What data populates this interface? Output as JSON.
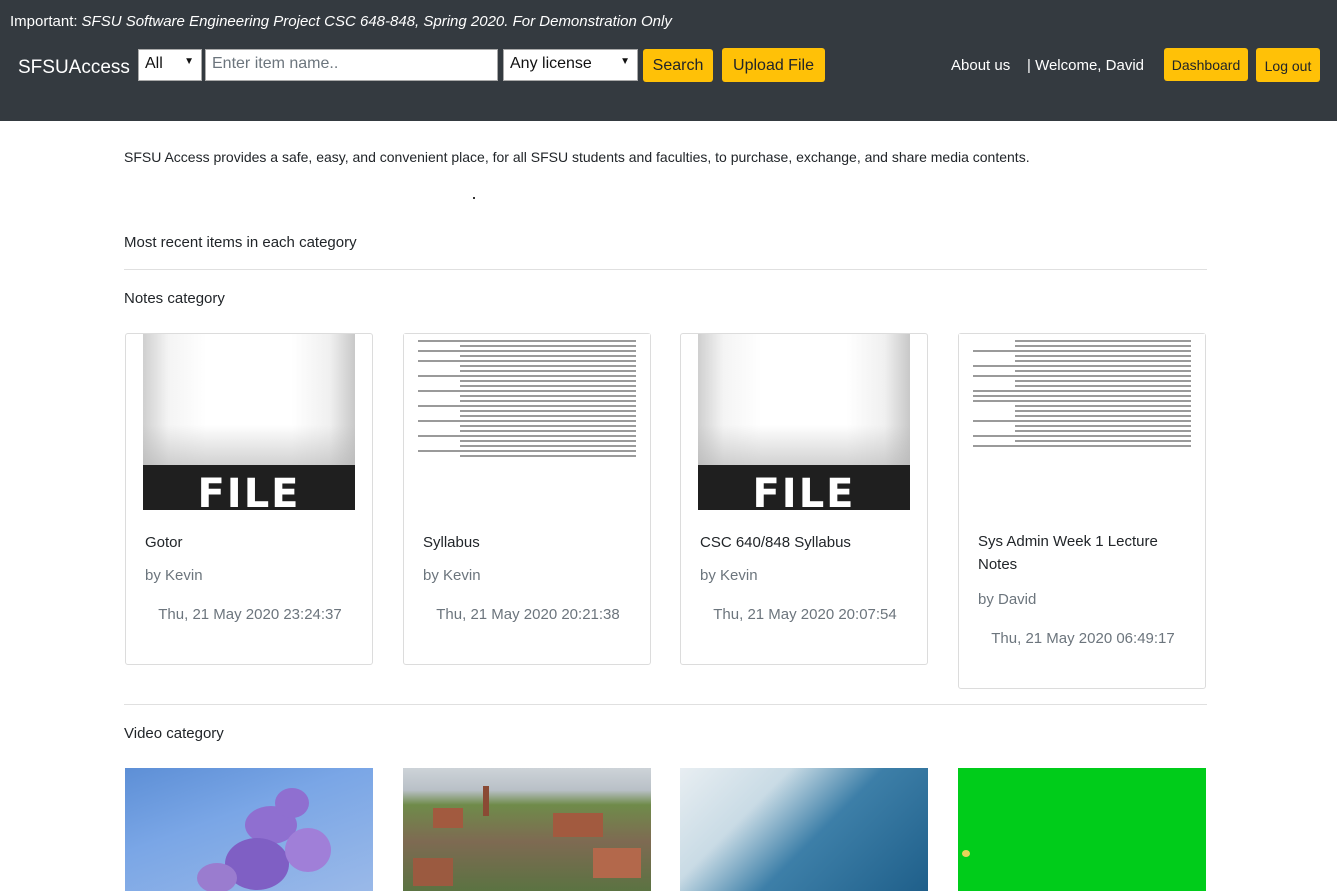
{
  "banner": {
    "label": "Important:",
    "text": "SFSU Software Engineering Project CSC 648-848, Spring 2020. For Demonstration Only"
  },
  "navbar": {
    "brand": "SFSUAccess",
    "category_select": "All",
    "search_placeholder": "Enter item name..",
    "license_select": "Any license",
    "search_button": "Search",
    "upload_button": "Upload File",
    "about_link": "About us",
    "welcome": "| Welcome, David",
    "dashboard_button": "Dashboard",
    "logout_button": "Log out"
  },
  "intro": "SFSU Access provides a safe, easy, and convenient place, for all SFSU students and faculties, to purchase, exchange, and share media contents.",
  "recent_heading": "Most recent items in each category",
  "notes": {
    "heading": "Notes category",
    "items": [
      {
        "title": "Gotor",
        "author": "by Kevin",
        "date": "Thu, 21 May 2020 23:24:37",
        "thumb_text": "FILE"
      },
      {
        "title": "Syllabus",
        "author": "by Kevin",
        "date": "Thu, 21 May 2020 20:21:38"
      },
      {
        "title": "CSC 640/848 Syllabus",
        "author": "by Kevin",
        "date": "Thu, 21 May 2020 20:07:54",
        "thumb_text": "FILE"
      },
      {
        "title": "Sys Admin Week 1 Lecture Notes",
        "author": "by David",
        "date": "Thu, 21 May 2020 06:49:17"
      }
    ]
  },
  "video": {
    "heading": "Video category"
  },
  "icons": {
    "select_caret": "caret-down-icon"
  },
  "colors": {
    "navbar_bg": "#343a40",
    "accent_button": "#ffc107"
  }
}
